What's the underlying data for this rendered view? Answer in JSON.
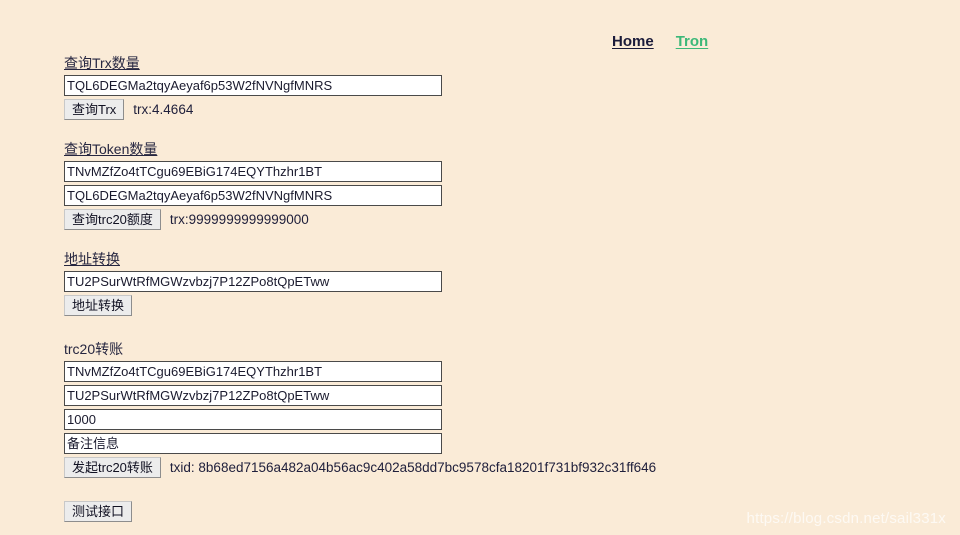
{
  "nav": {
    "home_label": "Home",
    "tron_label": "Tron",
    "home_color": "#1b1b3a",
    "tron_color": "#3cb878"
  },
  "page": {
    "background_color": "#faebd7",
    "watermark": "https://blog.csdn.net/sail331x"
  },
  "sections": {
    "trx_query": {
      "title": "查询Trx数量",
      "address_value": "TQL6DEGMa2tqyAeyaf6p53W2fNVNgfMNRS",
      "address_placeholder": "",
      "button_label": "查询Trx",
      "result": "trx:4.4664"
    },
    "token_query": {
      "title": "查询Token数量",
      "contract_value": "TNvMZfZo4tTCgu69EBiG174EQYThzhr1BT",
      "contract_placeholder": "",
      "address_value": "TQL6DEGMa2tqyAeyaf6p53W2fNVNgfMNRS",
      "address_placeholder": "",
      "button_label": "查询trc20额度",
      "result": "trx:9999999999999000"
    },
    "address_convert": {
      "title": "地址转换",
      "address_value": "TU2PSurWtRfMGWzvbzj7P12ZPo8tQpETww",
      "address_placeholder": "",
      "button_label": "地址转换"
    },
    "trc20_transfer": {
      "title": "trc20转账",
      "contract_value": "TNvMZfZo4tTCgu69EBiG174EQYThzhr1BT",
      "contract_placeholder": "",
      "to_address_value": "TU2PSurWtRfMGWzvbzj7P12ZPo8tQpETww",
      "to_address_placeholder": "",
      "amount_value": "1000",
      "amount_placeholder": "",
      "memo_value": "备注信息",
      "memo_placeholder": "",
      "button_label": "发起trc20转账",
      "result": "txid: 8b68ed7156a482a04b56ac9c402a58dd7bc9578cfa18201f731bf932c31ff646"
    },
    "test": {
      "button_label": "测试接口"
    }
  }
}
